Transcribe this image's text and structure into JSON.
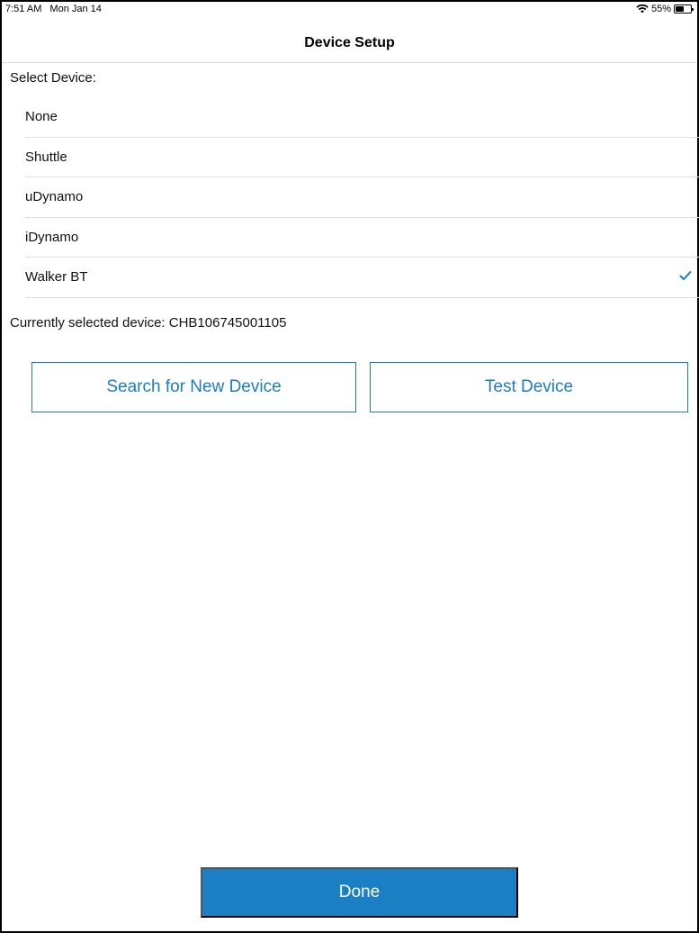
{
  "status_bar": {
    "time": "7:51 AM",
    "date": "Mon Jan 14",
    "battery_percent": "55%",
    "battery_level": 0.55
  },
  "nav": {
    "title": "Device Setup"
  },
  "device_section": {
    "label": "Select Device:",
    "devices": [
      {
        "name": "None",
        "selected": false
      },
      {
        "name": "Shuttle",
        "selected": false
      },
      {
        "name": "uDynamo",
        "selected": false
      },
      {
        "name": "iDynamo",
        "selected": false
      },
      {
        "name": "Walker BT",
        "selected": true
      }
    ],
    "current_device_text": "Currently selected device: CHB106745001105"
  },
  "actions": {
    "search_label": "Search for New Device",
    "test_label": "Test Device",
    "done_label": "Done"
  },
  "colors": {
    "accent": "#1c7cc6",
    "done_background": "#1b7fc4"
  },
  "icons": {
    "wifi": "wifi-icon",
    "battery": "battery-icon",
    "check": "checkmark-icon"
  }
}
